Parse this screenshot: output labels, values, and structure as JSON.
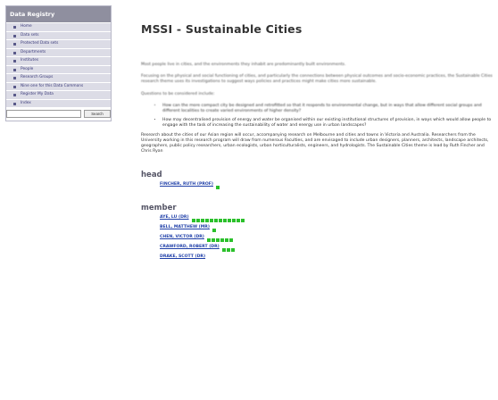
{
  "sidebar": {
    "title": "Data Registry",
    "items": [
      {
        "label": "Home"
      },
      {
        "label": "Data sets"
      },
      {
        "label": "Protected Data sets"
      },
      {
        "label": "Departments"
      },
      {
        "label": "Institutes"
      },
      {
        "label": "People"
      },
      {
        "label": "Research Groups"
      },
      {
        "label": "Nine one for this Data Commons"
      },
      {
        "label": "Register My Data"
      },
      {
        "label": "Index"
      }
    ],
    "search": {
      "value": "",
      "button_label": "Search"
    }
  },
  "main": {
    "title": "MSSI - Sustainable Cities",
    "intro": "Most people live in cities, and the environments they inhabit are predominantly built environments.",
    "focus": "Focusing on the physical and social functioning of cities, and particularly the connections between physical outcomes and socio-economic practices, the Sustainable Cities research theme uses its investigations to suggest ways policies and practices might make cities more sustainable.",
    "questions_label": "Questions to be considered include:",
    "questions": [
      "How can the more compact city be designed and retrofitted so that it responds to environmental change, but in ways that allow different social groups and different localities to create varied environments of higher density?",
      "How may decentralised provision of energy and water be organised within our existing institutional structures of provision, in ways which would allow people to engage with the task of increasing the sustainability of water and energy use in urban landscapes?"
    ],
    "research": "Research about the cities of our Asian region will occur, accompanying research on Melbourne and cities and towns in Victoria and Australia. Researchers from the University working in this research program will draw from numerous Faculties, and are envisaged to include urban designers, planners, architects, landscape architects, geographers, public policy researchers, urban ecologists, urban horticulturalists, engineers, and hydrologists. The Sustainable Cities theme is lead by Ruth Fincher and Chris Ryan",
    "head_label": "head",
    "head": [
      {
        "name": "FINCHER, RUTH (PROF)",
        "count": 1
      }
    ],
    "member_label": "member",
    "members": [
      {
        "name": "AYE, LU (DR)",
        "count": 12
      },
      {
        "name": "BELL, MATTHEW (MR)",
        "count": 1
      },
      {
        "name": "CHEN, VICTOR (DR)",
        "count": 6
      },
      {
        "name": "CRAWFORD, ROBERT (DR)",
        "count": 3
      },
      {
        "name": "DRAKE, SCOTT (DR)",
        "count": 0
      }
    ]
  },
  "colors": {
    "accent_green": "#2bc02b",
    "link_blue": "#1f3fa8",
    "sidebar_header": "#8f8f9f"
  }
}
